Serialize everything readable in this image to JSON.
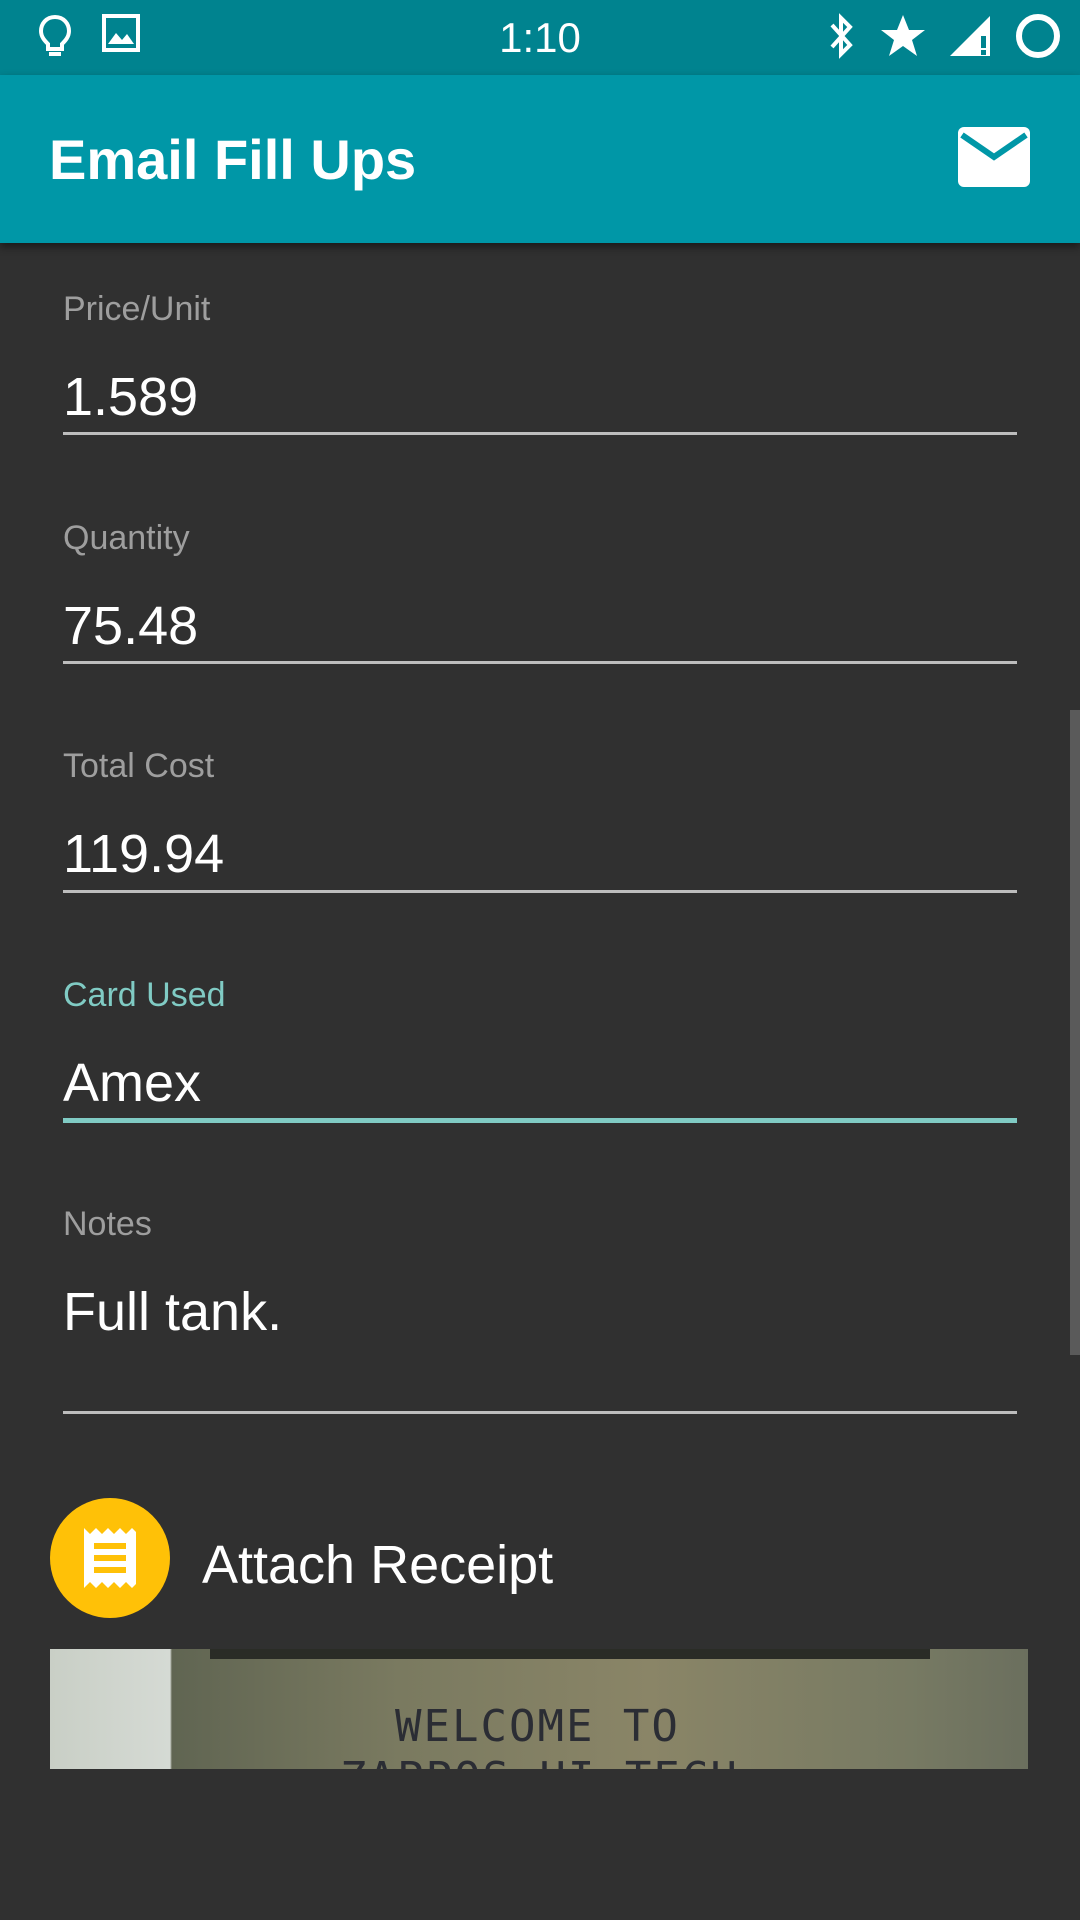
{
  "status_bar": {
    "time": "1:10",
    "left_icons": [
      "lightbulb-icon",
      "image-icon"
    ],
    "right_icons": [
      "bluetooth-icon",
      "star-icon",
      "signal-icon",
      "loading-ring-icon"
    ]
  },
  "app_bar": {
    "title": "Email Fill Ups",
    "action_icon": "email-icon"
  },
  "form": {
    "price_unit": {
      "label": "Price/Unit",
      "value": "1.589"
    },
    "quantity": {
      "label": "Quantity",
      "value": "75.48"
    },
    "total_cost": {
      "label": "Total Cost",
      "value": "119.94"
    },
    "card_used": {
      "label": "Card Used",
      "value": "Amex"
    },
    "notes": {
      "label": "Notes",
      "value": "Full tank."
    }
  },
  "attach": {
    "label": "Attach Receipt",
    "icon": "receipt-icon"
  },
  "receipt_image": {
    "line1": "WELCOME TO",
    "line2": "ZAPPOS HI TECH"
  },
  "colors": {
    "status_bar": "#00838f",
    "app_bar": "#0097a7",
    "background": "#303030",
    "accent": "#80cbc4",
    "attach_button": "#ffc107"
  }
}
